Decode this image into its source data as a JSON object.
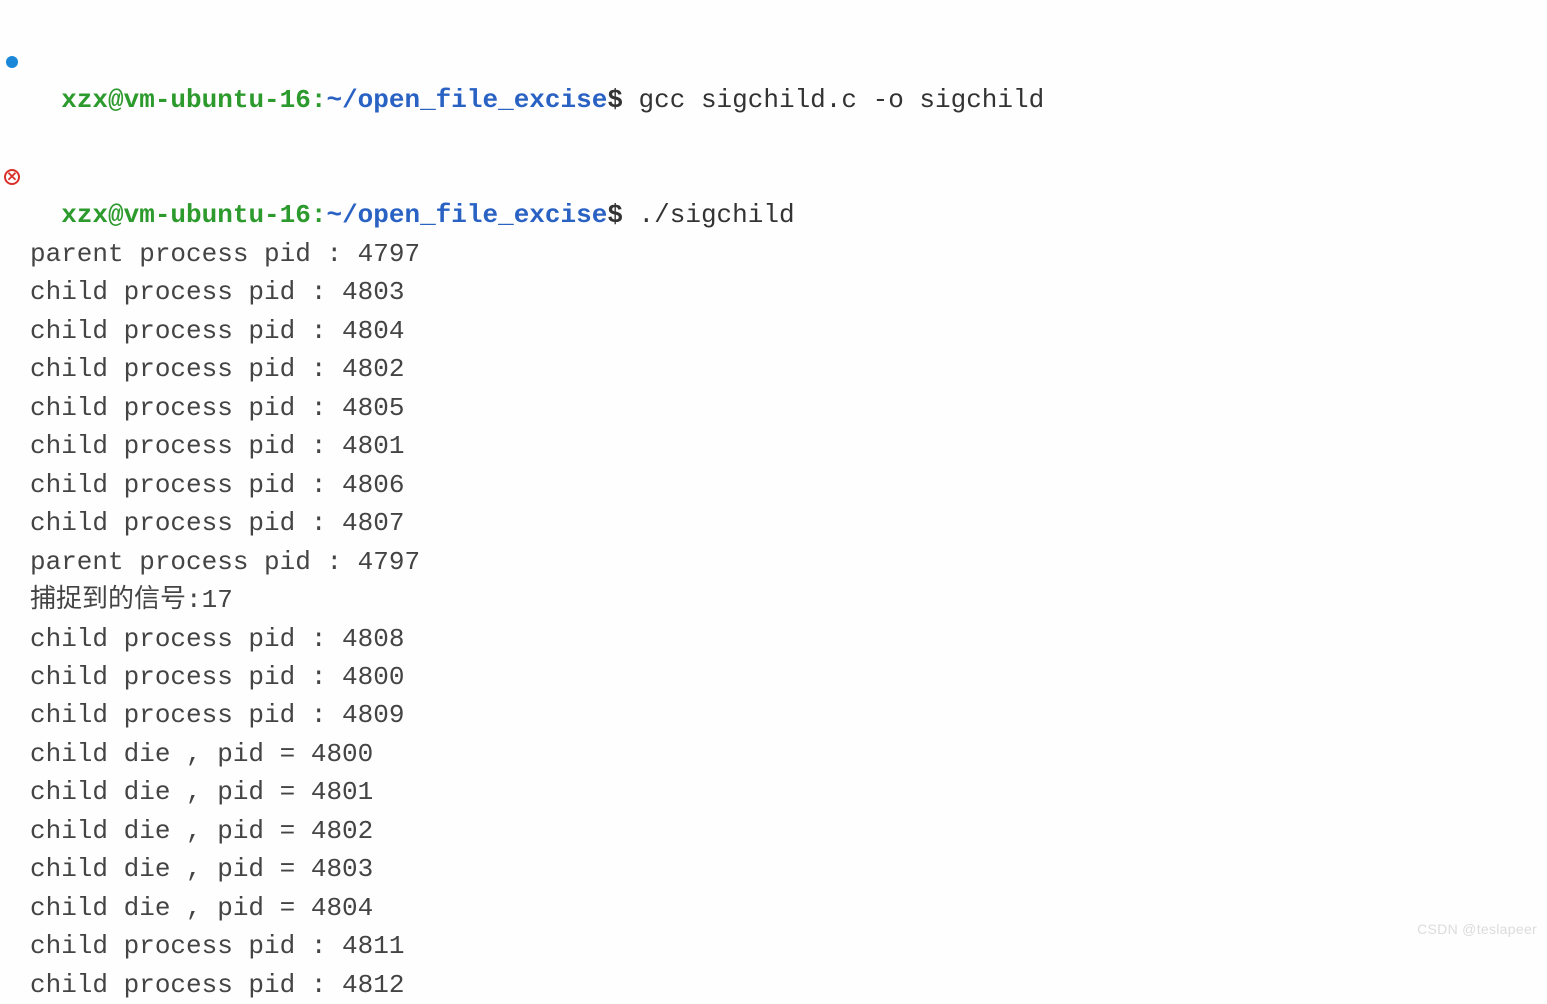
{
  "prompt": {
    "user_host": "xzx@vm-ubuntu-16",
    "colon": ":",
    "cwd": "~/open_file_excise",
    "dollar": "$"
  },
  "commands": [
    "gcc sigchild.c -o sigchild",
    "./sigchild"
  ],
  "output": [
    "parent process pid : 4797",
    "child process pid : 4803",
    "child process pid : 4804",
    "child process pid : 4802",
    "child process pid : 4805",
    "child process pid : 4801",
    "child process pid : 4806",
    "child process pid : 4807",
    "parent process pid : 4797",
    "捕捉到的信号:17",
    "child process pid : 4808",
    "child process pid : 4800",
    "child process pid : 4809",
    "child die , pid = 4800",
    "child die , pid = 4801",
    "child die , pid = 4802",
    "child die , pid = 4803",
    "child die , pid = 4804",
    "child process pid : 4811",
    "child process pid : 4812"
  ],
  "watermark": "CSDN @teslapeer",
  "gutter": {
    "red_x": "✕"
  }
}
